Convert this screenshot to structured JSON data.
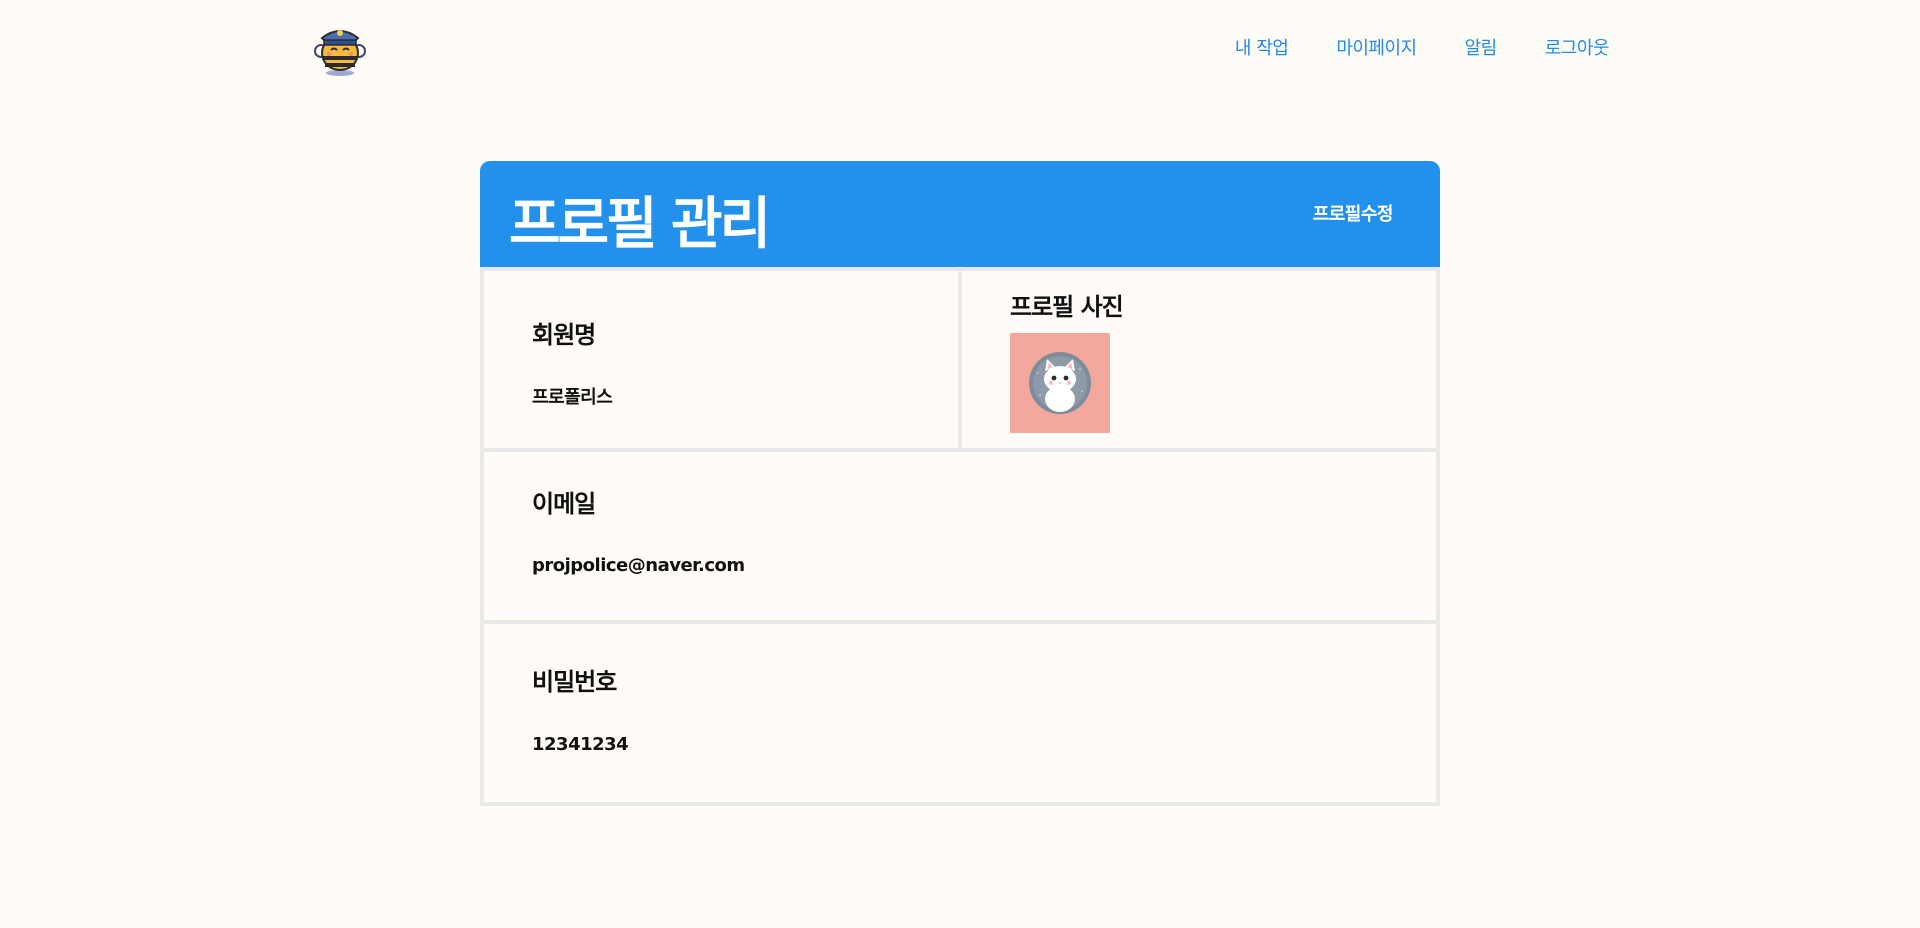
{
  "header": {
    "logo_icon": "police-bee-mascot-icon",
    "nav": [
      {
        "label": "내 작업"
      },
      {
        "label": "마이페이지"
      },
      {
        "label": "알림"
      },
      {
        "label": "로그아웃"
      }
    ]
  },
  "card": {
    "title": "프로필 관리",
    "edit_label": "프로필수정",
    "name_label": "회원명",
    "name_value": "프로폴리스",
    "photo_label": "프로필 사진",
    "photo_icon": "white-cat-avatar-icon",
    "email_label": "이메일",
    "email_value": "projpolice@naver.com",
    "password_label": "비밀번호",
    "password_value": "12341234"
  },
  "colors": {
    "accent": "#2391ec",
    "nav_text": "#1f8ae8",
    "background": "#fffcf7",
    "photo_bg": "#f2a89d"
  }
}
